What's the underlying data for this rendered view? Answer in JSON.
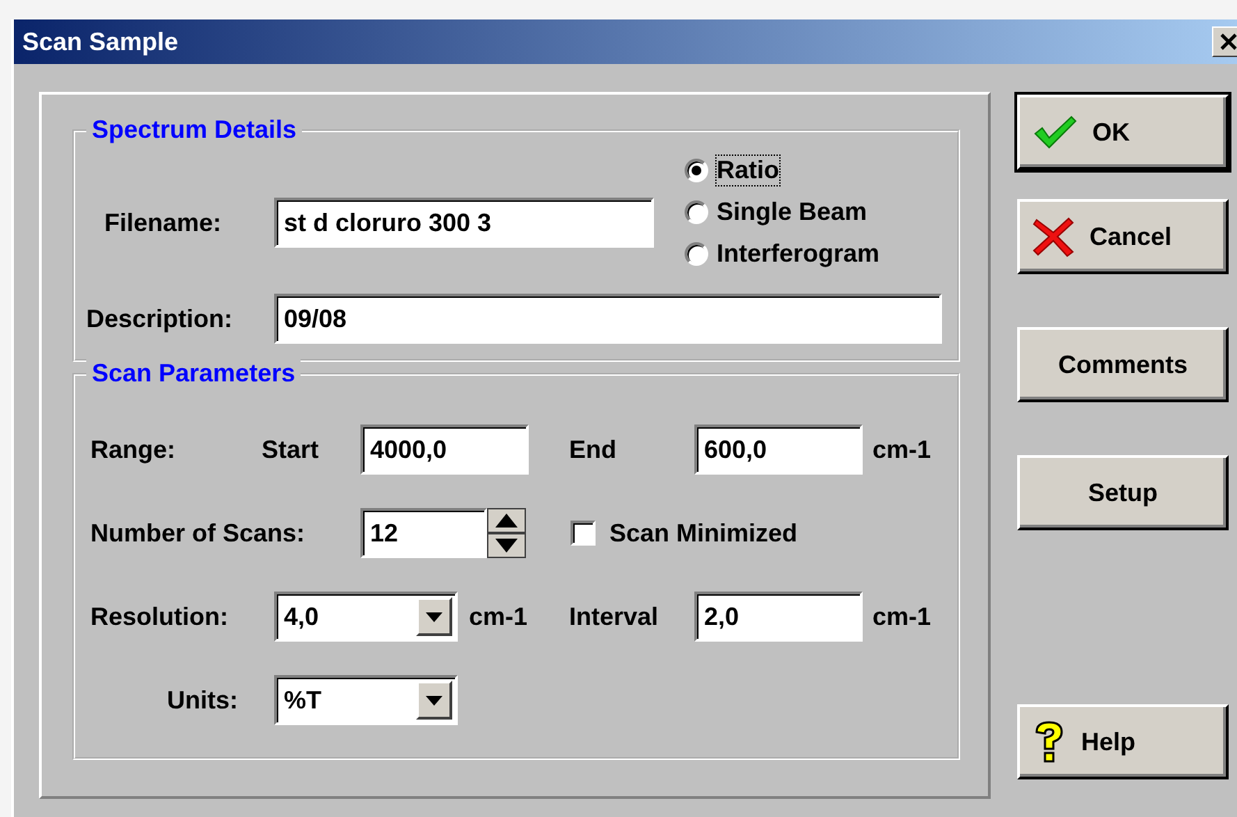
{
  "window": {
    "title": "Scan Sample"
  },
  "spectrum_details": {
    "title": "Spectrum Details",
    "filename": {
      "label": "Filename:",
      "value": "st d cloruro 300 3"
    },
    "beam_modes": [
      {
        "label": "Ratio",
        "selected": true,
        "focused": true
      },
      {
        "label": "Single Beam",
        "selected": false,
        "focused": false
      },
      {
        "label": "Interferogram",
        "selected": false,
        "focused": false
      }
    ],
    "description": {
      "label": "Description:",
      "value": "09/08"
    }
  },
  "scan_parameters": {
    "title": "Scan Parameters",
    "range_label": "Range:",
    "start": {
      "label": "Start",
      "value": "4000,0"
    },
    "end": {
      "label": "End",
      "value": "600,0",
      "unit": "cm-1"
    },
    "number_of_scans": {
      "label": "Number of Scans:",
      "value": "12"
    },
    "scan_minimized": {
      "label": "Scan Minimized",
      "checked": false
    },
    "resolution": {
      "label": "Resolution:",
      "value": "4,0",
      "unit": "cm-1"
    },
    "interval": {
      "label": "Interval",
      "value": "2,0",
      "unit": "cm-1"
    },
    "units": {
      "label": "Units:",
      "value": "%T"
    }
  },
  "buttons": [
    {
      "label": "OK",
      "kind": "check"
    },
    {
      "label": "Cancel",
      "kind": "cross"
    },
    {
      "label": "Comments",
      "kind": "plain"
    },
    {
      "label": "Setup",
      "kind": "plain"
    },
    {
      "label": "Help",
      "kind": "question"
    }
  ]
}
